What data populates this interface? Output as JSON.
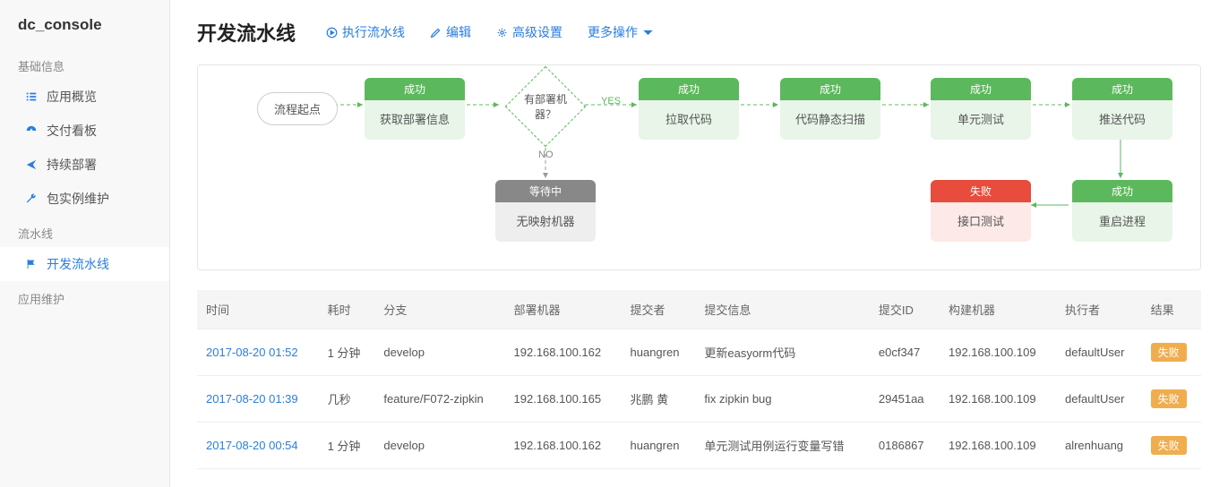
{
  "app_name": "dc_console",
  "sidebar": {
    "sections": [
      {
        "label": "基础信息",
        "items": [
          {
            "icon": "list-icon",
            "label": "应用概览"
          },
          {
            "icon": "dashboard-icon",
            "label": "交付看板"
          },
          {
            "icon": "plane-icon",
            "label": "持续部署"
          },
          {
            "icon": "wrench-icon",
            "label": "包实例维护"
          }
        ]
      },
      {
        "label": "流水线",
        "items": [
          {
            "icon": "flag-icon",
            "label": "开发流水线",
            "active": true
          }
        ]
      },
      {
        "label": "应用维护",
        "items": []
      }
    ]
  },
  "page_title": "开发流水线",
  "toolbar": {
    "run": "执行流水线",
    "edit": "编辑",
    "advanced": "高级设置",
    "more": "更多操作"
  },
  "pipeline": {
    "start": "流程起点",
    "decision": "有部署机器？",
    "yes_label": "YES",
    "no_label": "NO",
    "stages": {
      "fetch": {
        "status": "成功",
        "name": "获取部署信息",
        "type": "success"
      },
      "pull": {
        "status": "成功",
        "name": "拉取代码",
        "type": "success"
      },
      "scan": {
        "status": "成功",
        "name": "代码静态扫描",
        "type": "success"
      },
      "unit": {
        "status": "成功",
        "name": "单元测试",
        "type": "success"
      },
      "push": {
        "status": "成功",
        "name": "推送代码",
        "type": "success"
      },
      "restart": {
        "status": "成功",
        "name": "重启进程",
        "type": "success"
      },
      "api": {
        "status": "失败",
        "name": "接口测试",
        "type": "fail"
      },
      "wait": {
        "status": "等待中",
        "name": "无映射机器",
        "type": "wait"
      }
    }
  },
  "table": {
    "headers": {
      "time": "时间",
      "duration": "耗时",
      "branch": "分支",
      "deploy": "部署机器",
      "committer": "提交者",
      "msg": "提交信息",
      "commit": "提交ID",
      "builder": "构建机器",
      "executor": "执行者",
      "result": "结果"
    },
    "rows": [
      {
        "time": "2017-08-20 01:52",
        "duration": "1 分钟",
        "branch": "develop",
        "deploy": "192.168.100.162",
        "committer": "huangren",
        "msg": "更新easyorm代码",
        "commit": "e0cf347",
        "builder": "192.168.100.109",
        "executor": "defaultUser",
        "result": "失败"
      },
      {
        "time": "2017-08-20 01:39",
        "duration": "几秒",
        "branch": "feature/F072-zipkin",
        "deploy": "192.168.100.165",
        "committer": "兆鹏 黄",
        "msg": "fix zipkin bug",
        "commit": "29451aa",
        "builder": "192.168.100.109",
        "executor": "defaultUser",
        "result": "失败"
      },
      {
        "time": "2017-08-20 00:54",
        "duration": "1 分钟",
        "branch": "develop",
        "deploy": "192.168.100.162",
        "committer": "huangren",
        "msg": "单元测试用例运行变量写错",
        "commit": "0186867",
        "builder": "192.168.100.109",
        "executor": "alrenhuang",
        "result": "失败"
      }
    ]
  }
}
